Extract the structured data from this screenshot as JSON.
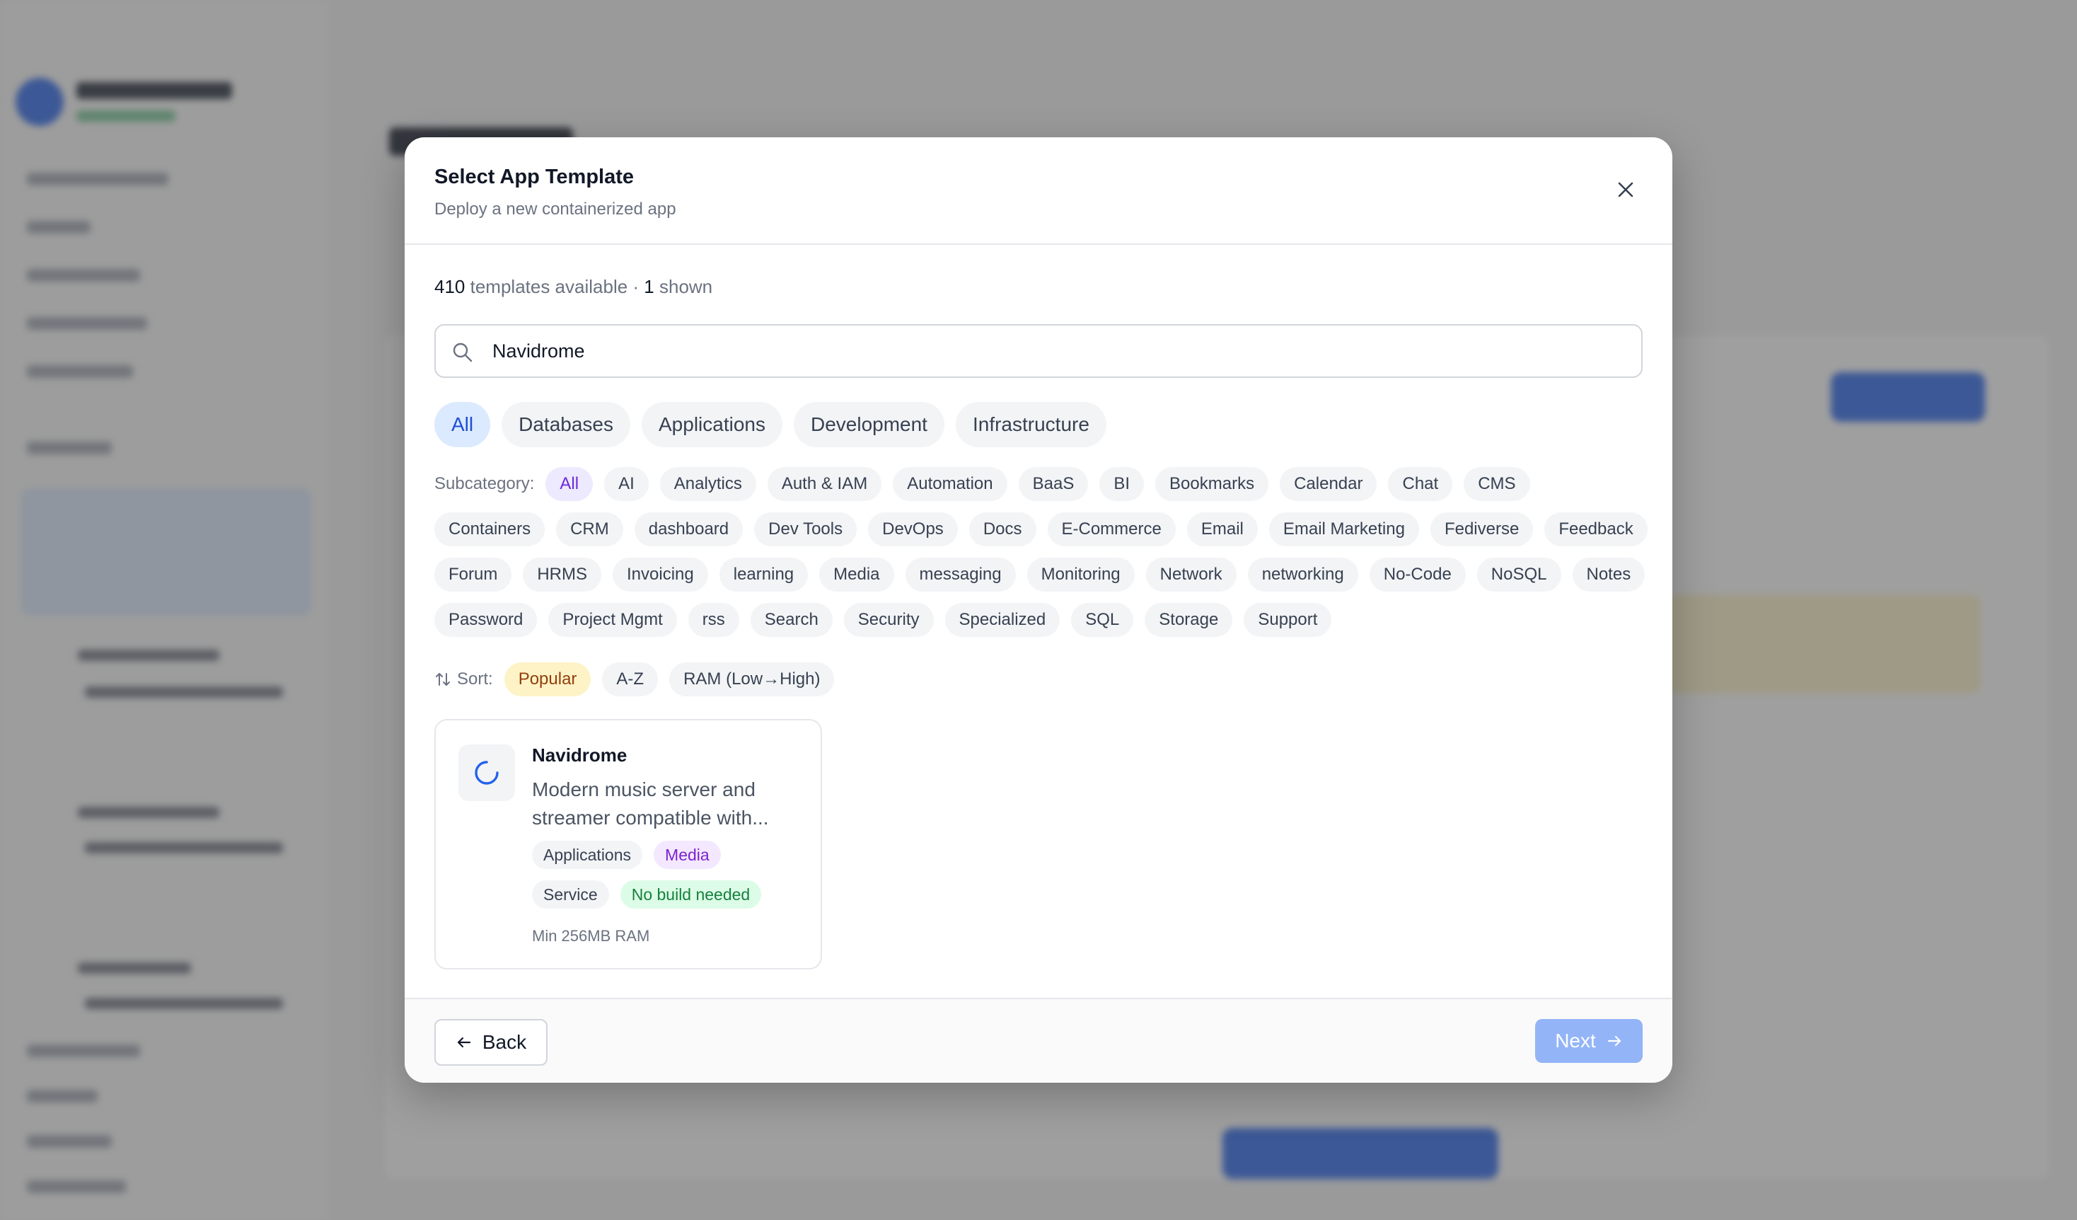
{
  "modal": {
    "title": "Select App Template",
    "subtitle": "Deploy a new containerized app"
  },
  "counts": {
    "total": "410",
    "total_suffix": " templates available · ",
    "shown": "1",
    "shown_suffix": " shown"
  },
  "search": {
    "value": "Navidrome"
  },
  "categories": [
    "All",
    "Databases",
    "Applications",
    "Development",
    "Infrastructure"
  ],
  "active_category": "All",
  "subcategory_label": "Subcategory:",
  "subcategories": [
    "All",
    "AI",
    "Analytics",
    "Auth & IAM",
    "Automation",
    "BaaS",
    "BI",
    "Bookmarks",
    "Calendar",
    "Chat",
    "CMS",
    "Containers",
    "CRM",
    "dashboard",
    "Dev Tools",
    "DevOps",
    "Docs",
    "E-Commerce",
    "Email",
    "Email Marketing",
    "Fediverse",
    "Feedback",
    "Forum",
    "HRMS",
    "Invoicing",
    "learning",
    "Media",
    "messaging",
    "Monitoring",
    "Network",
    "networking",
    "No-Code",
    "NoSQL",
    "Notes",
    "Password",
    "Project Mgmt",
    "rss",
    "Search",
    "Security",
    "Specialized",
    "SQL",
    "Storage",
    "Support"
  ],
  "active_subcategory": "All",
  "sort": {
    "label": "Sort:",
    "options": [
      "Popular",
      "A-Z",
      "RAM (Low→High)"
    ],
    "active": "Popular"
  },
  "card": {
    "name": "Navidrome",
    "description": "Modern music server and streamer compatible with...",
    "tags_row1": [
      {
        "label": "Applications",
        "style": "gray"
      },
      {
        "label": "Media",
        "style": "purple"
      }
    ],
    "tags_row2": [
      {
        "label": "Service",
        "style": "gray"
      },
      {
        "label": "No build needed",
        "style": "green"
      }
    ],
    "ram": "Min 256MB RAM",
    "icon": "loader-icon"
  },
  "footer": {
    "back_label": "Back",
    "next_label": "Next"
  },
  "colors": {
    "accent": "#2563eb",
    "active_category_bg": "#dbeafe",
    "active_subcategory_bg": "#ede9fe",
    "active_sort_bg": "#fef3c7",
    "next_disabled": "#93b4f7"
  }
}
